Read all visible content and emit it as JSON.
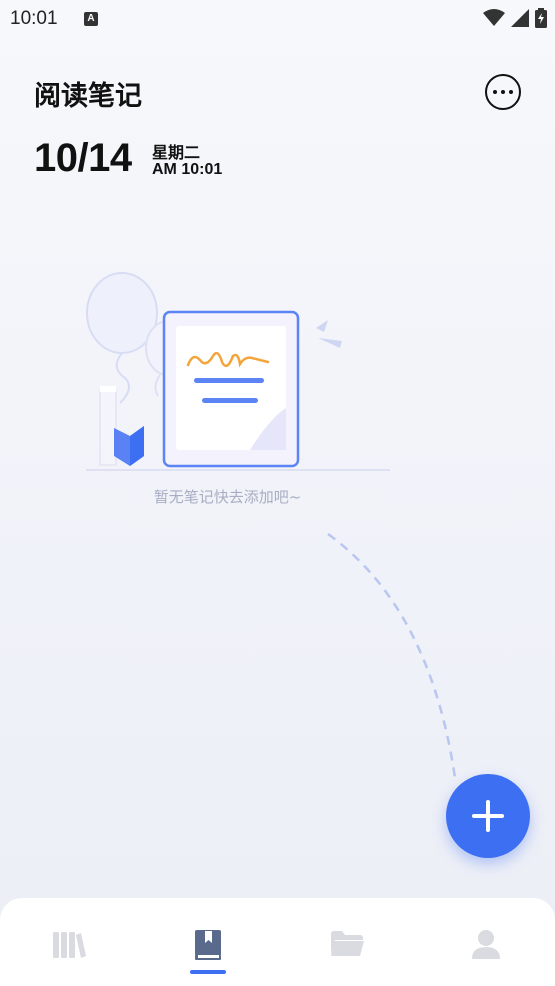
{
  "status_bar": {
    "time": "10:01",
    "notification_letter": "A"
  },
  "header": {
    "title": "阅读笔记",
    "more_icon": "more-horizontal-icon"
  },
  "date_block": {
    "date": "10/14",
    "weekday": "星期二",
    "time": "AM 10:01"
  },
  "empty_state": {
    "message": "暂无笔记快去添加吧~"
  },
  "fab": {
    "icon": "plus-icon",
    "color": "#3d6ff2"
  },
  "bottom_nav": {
    "items": [
      {
        "icon": "bookshelf-icon",
        "active": false
      },
      {
        "icon": "notebook-icon",
        "active": true
      },
      {
        "icon": "folder-icon",
        "active": false
      },
      {
        "icon": "profile-icon",
        "active": false
      }
    ],
    "active_color": "#5a6a8c",
    "inactive_color": "#d9dbe0"
  }
}
